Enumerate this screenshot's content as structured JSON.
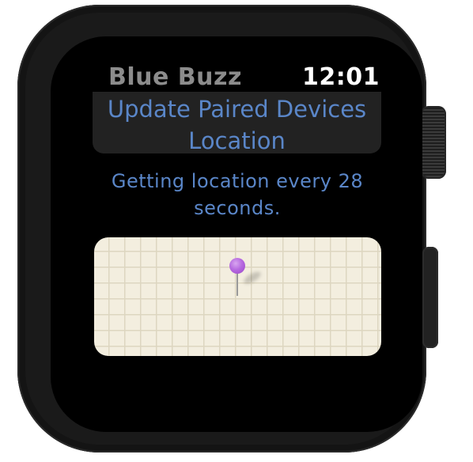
{
  "app": {
    "title": "Blue Buzz",
    "time": "12:01"
  },
  "main": {
    "update_button_label": "Update Paired Devices Location",
    "status_text": "Getting location every 28 seconds."
  },
  "colors": {
    "accent": "#5a86c8",
    "title_gray": "#8c8c8c",
    "button_bg": "#222222",
    "map_bg": "#f3eedf",
    "pin": "#b76be0"
  },
  "icons": {
    "map_pin": "map-pin-icon"
  }
}
